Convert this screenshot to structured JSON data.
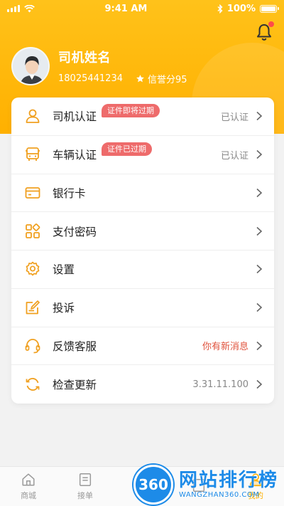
{
  "status_bar": {
    "time": "9:41 AM",
    "battery": "100%"
  },
  "profile": {
    "name": "司机姓名",
    "phone": "18025441234",
    "credit_score": "信誉分95"
  },
  "menu": [
    {
      "label": "司机认证",
      "value": "已认证",
      "badge": "证件即将过期",
      "icon": "person-icon"
    },
    {
      "label": "车辆认证",
      "value": "已认证",
      "badge": "证件已过期",
      "icon": "bus-icon"
    },
    {
      "label": "银行卡",
      "value": "",
      "icon": "card-icon"
    },
    {
      "label": "支付密码",
      "value": "",
      "icon": "grid-icon"
    },
    {
      "label": "设置",
      "value": "",
      "icon": "gear-icon"
    },
    {
      "label": "投诉",
      "value": "",
      "icon": "edit-icon"
    },
    {
      "label": "反馈客服",
      "value": "你有新消息",
      "icon": "headset-icon"
    },
    {
      "label": "检查更新",
      "value": "3.31.11.100",
      "icon": "refresh-icon"
    }
  ],
  "tabs": [
    {
      "label": "商城",
      "icon": "home-icon"
    },
    {
      "label": "接单",
      "icon": "list-icon"
    },
    {
      "label": "",
      "icon": "doc-icon"
    },
    {
      "label": "",
      "icon": "doc-icon"
    },
    {
      "label": "我的",
      "icon": "user-icon"
    }
  ],
  "watermark": {
    "logo": "360",
    "title": "网站排行榜",
    "subtitle": "WANGZHAN360.COM"
  },
  "colors": {
    "accent": "#ffb000",
    "badge": "#ee6b6b",
    "alert": "#e0533d",
    "icon": "#f0a020"
  }
}
